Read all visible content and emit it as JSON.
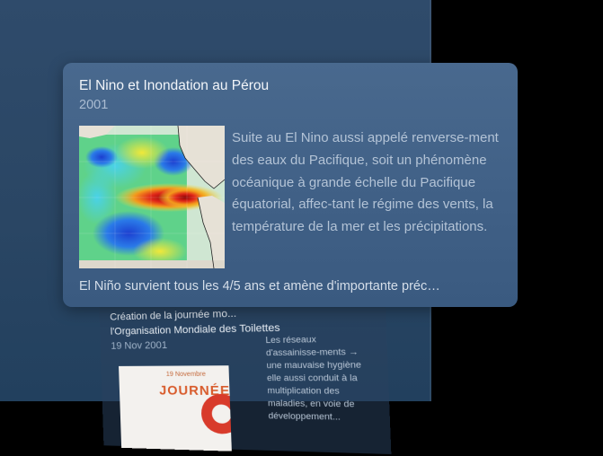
{
  "popup": {
    "title": "El Nino et Inondation au Pérou",
    "year": "2001",
    "description": "Suite au El Nino aussi appelé renverse-ment des eaux du Pacifique, soit un phénomène océanique à grande échelle du Pacifique équatorial, affec-tant le régime des vents, la température de la mer et les précipitations.",
    "footer": "El Niño survient tous les 4/5 ans et amène d'importante préc…",
    "map_label": "sea-surface-temperature-anomaly-map"
  },
  "background_card": {
    "title_line1": "Création de la journée mo...",
    "title_line2": "l'Organisation Mondiale des Toilettes",
    "date": "19 Nov 2001",
    "thumb_line1": "19 Novembre",
    "thumb_line2": "JOURNÉE",
    "description": "Les réseaux d'assainisse-ments → une mauvaise hygiène elle aussi conduit à la multiplication des maladies, en voie de développement..."
  },
  "colors": {
    "panel": "#2f4b6b",
    "card": "#456589",
    "title": "#f2f5f9",
    "muted": "#aabcd2"
  }
}
